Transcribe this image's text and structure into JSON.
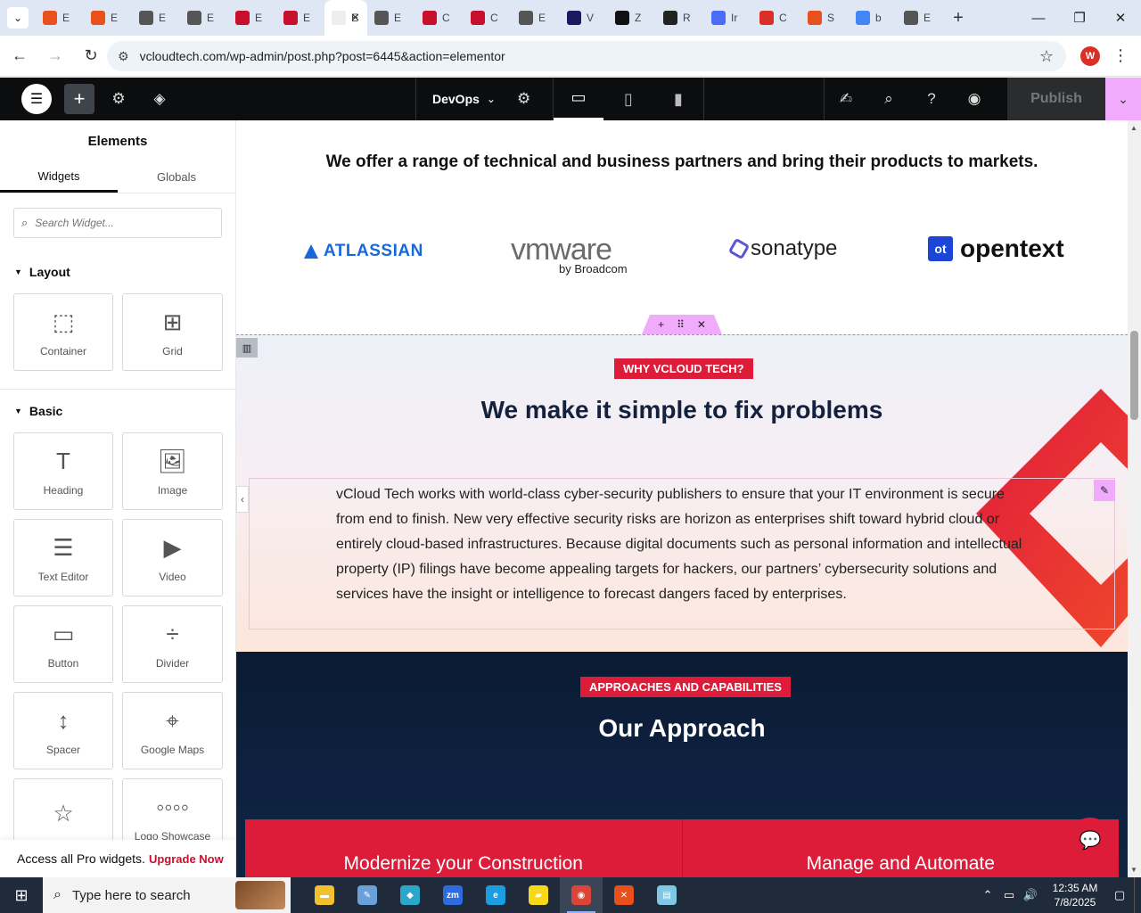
{
  "browser": {
    "tabs": [
      {
        "letter": "E",
        "color": "#e8501c",
        "icon": "xampp-icon"
      },
      {
        "letter": "E",
        "color": "#e8501c",
        "icon": "xampp-icon"
      },
      {
        "letter": "E",
        "color": "#555555",
        "icon": "wordpress-icon"
      },
      {
        "letter": "E",
        "color": "#555555",
        "icon": "wordpress-icon"
      },
      {
        "letter": "E",
        "color": "#c8102e",
        "icon": "vcloud-icon"
      },
      {
        "letter": "E",
        "color": "#c8102e",
        "icon": "vcloud-icon"
      },
      {
        "letter": "E",
        "color": "#ffffff",
        "icon": "elementor-icon",
        "active": true
      },
      {
        "letter": "E",
        "color": "#555555",
        "icon": "wordpress-icon"
      },
      {
        "letter": "C",
        "color": "#c8102e",
        "icon": "vcloud-icon"
      },
      {
        "letter": "C",
        "color": "#c8102e",
        "icon": "vcloud-icon"
      },
      {
        "letter": "E",
        "color": "#555555",
        "icon": "wordpress-icon"
      },
      {
        "letter": "V",
        "color": "#1a1a5e",
        "icon": "v-icon"
      },
      {
        "letter": "Z",
        "color": "#111111",
        "icon": "z-icon"
      },
      {
        "letter": "R",
        "color": "#222222",
        "icon": "r-icon"
      },
      {
        "letter": "Ir",
        "color": "#4a6cf7",
        "icon": "ir-icon"
      },
      {
        "letter": "C",
        "color": "#d93025",
        "icon": "c-icon"
      },
      {
        "letter": "S",
        "color": "#e8501c",
        "icon": "s-icon"
      },
      {
        "letter": "b",
        "color": "#4285f4",
        "icon": "google-icon"
      },
      {
        "letter": "E",
        "color": "#555555",
        "icon": "wordpress-icon"
      }
    ],
    "url": "vcloudtech.com/wp-admin/post.php?post=6445&action=elementor",
    "profile_initial": "W"
  },
  "editor": {
    "document_name": "DevOps",
    "publish_label": "Publish"
  },
  "panel": {
    "title": "Elements",
    "tabs": [
      "Widgets",
      "Globals"
    ],
    "search_placeholder": "Search Widget...",
    "layout_heading": "Layout",
    "layout_widgets": [
      {
        "label": "Container",
        "icon": "container-icon",
        "glyph": "⬚"
      },
      {
        "label": "Grid",
        "icon": "grid-icon",
        "glyph": "⊞"
      }
    ],
    "basic_heading": "Basic",
    "basic_widgets": [
      {
        "label": "Heading",
        "icon": "heading-icon",
        "glyph": "T"
      },
      {
        "label": "Image",
        "icon": "image-icon",
        "glyph": "🖼"
      },
      {
        "label": "Text Editor",
        "icon": "text-editor-icon",
        "glyph": "☰"
      },
      {
        "label": "Video",
        "icon": "video-icon",
        "glyph": "▶"
      },
      {
        "label": "Button",
        "icon": "button-icon",
        "glyph": "▭"
      },
      {
        "label": "Divider",
        "icon": "divider-icon",
        "glyph": "÷"
      },
      {
        "label": "Spacer",
        "icon": "spacer-icon",
        "glyph": "↕"
      },
      {
        "label": "Google Maps",
        "icon": "google-maps-icon",
        "glyph": "⌖"
      },
      {
        "label": "",
        "icon": "star-rating-icon",
        "glyph": "☆"
      },
      {
        "label": "Logo Showcase",
        "icon": "logo-showcase-icon",
        "glyph": "◦◦◦◦"
      }
    ],
    "pro_text": "Access all Pro widgets.",
    "pro_link": "Upgrade Now"
  },
  "page": {
    "partners_text": "We offer a range of technical and business partners and bring their products to markets.",
    "logos": {
      "atlassian": "ATLASSIAN",
      "vmware": "vmware",
      "vmware_sub": "by Broadcom",
      "sonatype": "sonatype",
      "opentext": "opentext",
      "opentext_mark": "ot"
    },
    "why_badge": "WHY VCLOUD TECH?",
    "why_title": "We make it simple to fix problems",
    "why_text": "vCloud Tech works with world-class cyber-security publishers to ensure that your IT environment is secure from end to finish. New very effective security risks are horizon as enterprises shift toward hybrid cloud or entirely cloud-based infrastructures. Because digital documents such as personal information and intellectual property (IP) filings have become appealing targets for hackers, our partners’ cybersecurity solutions and services have the insight or intelligence to forecast dangers faced by enterprises.",
    "approach_badge": "APPROACHES AND CAPABILITIES",
    "approach_title": "Our Approach",
    "cards": [
      "Modernize your Construction",
      "Manage and Automate"
    ],
    "colors": {
      "accent": "#dc1c39",
      "dark": "#0b1b33",
      "heading": "#14213d"
    }
  },
  "taskbar": {
    "search_placeholder": "Type here to search",
    "time": "12:35 AM",
    "date": "7/8/2025",
    "apps": [
      {
        "name": "file-explorer-icon",
        "color": "#f2c12e",
        "glyph": "▬"
      },
      {
        "name": "paint-icon",
        "color": "#6aa0d8",
        "glyph": "✎"
      },
      {
        "name": "app-diamond-icon",
        "color": "#2aa7c9",
        "glyph": "◆"
      },
      {
        "name": "zoom-icon",
        "color": "#2d6cdf",
        "glyph": "zm"
      },
      {
        "name": "edge-icon",
        "color": "#1b9de2",
        "glyph": "e"
      },
      {
        "name": "sticky-notes-icon",
        "color": "#f7d91a",
        "glyph": "▰"
      },
      {
        "name": "chrome-icon",
        "color": "#db4437",
        "glyph": "◉",
        "active": true
      },
      {
        "name": "xampp-icon",
        "color": "#e8501c",
        "glyph": "✕"
      },
      {
        "name": "notepad-icon",
        "color": "#7ec8e3",
        "glyph": "▤"
      }
    ]
  }
}
